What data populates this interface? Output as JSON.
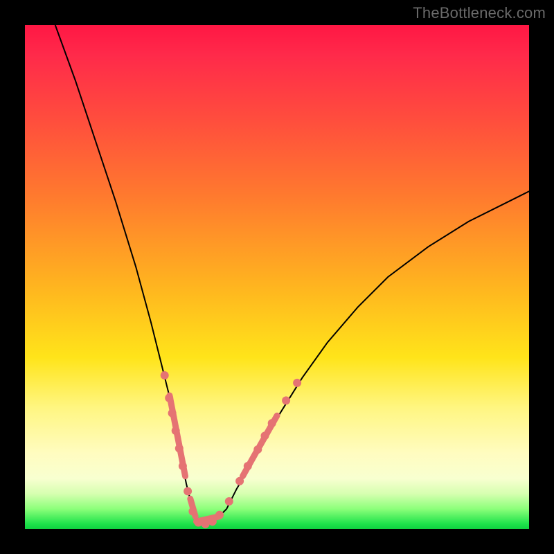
{
  "watermark": "TheBottleneck.com",
  "colors": {
    "frame": "#000000",
    "curve": "#000000",
    "beads": "#e57373",
    "gradient_top": "#ff1744",
    "gradient_bottom": "#10d040"
  },
  "chart_data": {
    "type": "line",
    "title": "",
    "xlabel": "",
    "ylabel": "",
    "xlim": [
      0,
      100
    ],
    "ylim": [
      0,
      100
    ],
    "grid": false,
    "series": [
      {
        "name": "bottleneck-curve",
        "x": [
          6,
          10,
          14,
          18,
          22,
          25,
          27,
          29,
          30,
          31,
          32,
          33,
          34,
          35,
          36,
          38,
          40,
          42,
          45,
          50,
          55,
          60,
          66,
          72,
          80,
          88,
          96,
          100
        ],
        "y": [
          100,
          89,
          77,
          65,
          52,
          41,
          33,
          25,
          20,
          14,
          9,
          5,
          2,
          1,
          1,
          2,
          4,
          8,
          13,
          22,
          30,
          37,
          44,
          50,
          56,
          61,
          65,
          67
        ]
      }
    ],
    "markers": {
      "name": "highlighted-points",
      "color": "#e57373",
      "points": [
        {
          "x": 27.7,
          "y": 30.5
        },
        {
          "x": 28.6,
          "y": 26.0
        },
        {
          "x": 29.2,
          "y": 23.0
        },
        {
          "x": 29.9,
          "y": 19.5
        },
        {
          "x": 30.6,
          "y": 16.0
        },
        {
          "x": 31.3,
          "y": 12.5
        },
        {
          "x": 32.3,
          "y": 7.5
        },
        {
          "x": 33.3,
          "y": 3.5
        },
        {
          "x": 34.4,
          "y": 1.3
        },
        {
          "x": 35.8,
          "y": 1.0
        },
        {
          "x": 37.2,
          "y": 1.5
        },
        {
          "x": 38.6,
          "y": 2.8
        },
        {
          "x": 40.5,
          "y": 5.5
        },
        {
          "x": 42.6,
          "y": 9.5
        },
        {
          "x": 44.2,
          "y": 12.5
        },
        {
          "x": 46.2,
          "y": 15.8
        },
        {
          "x": 47.6,
          "y": 18.5
        },
        {
          "x": 49.0,
          "y": 21.0
        },
        {
          "x": 51.8,
          "y": 25.5
        },
        {
          "x": 54.0,
          "y": 29.0
        }
      ]
    },
    "bead_segments": [
      {
        "x1": 28.7,
        "y1": 26.5,
        "x2": 31.8,
        "y2": 10.5
      },
      {
        "x1": 32.8,
        "y1": 6.0,
        "x2": 33.8,
        "y2": 2.5
      },
      {
        "x1": 34.0,
        "y1": 1.5,
        "x2": 38.5,
        "y2": 2.5
      },
      {
        "x1": 43.2,
        "y1": 10.5,
        "x2": 46.0,
        "y2": 15.5
      },
      {
        "x1": 46.6,
        "y1": 16.5,
        "x2": 50.0,
        "y2": 22.5
      }
    ]
  }
}
